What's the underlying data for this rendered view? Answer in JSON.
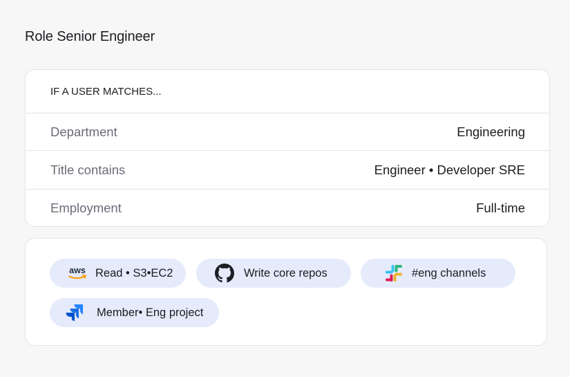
{
  "role": {
    "title": "Role Senior Engineer"
  },
  "rules": {
    "header": "IF A USER MATCHES...",
    "rows": [
      {
        "label": "Department",
        "value": "Engineering"
      },
      {
        "label": "Title contains",
        "value": "Engineer • Developer SRE"
      },
      {
        "label": "Employment",
        "value": "Full-time"
      }
    ]
  },
  "grants": [
    {
      "app": "aws",
      "icon": "aws-icon",
      "label": "Read • S3•EC2"
    },
    {
      "app": "github",
      "icon": "github-icon",
      "label": "Write core repos"
    },
    {
      "app": "slack",
      "icon": "slack-icon",
      "label": "#eng channels"
    },
    {
      "app": "jira",
      "icon": "jira-icon",
      "label": "Member• Eng project"
    }
  ],
  "colors": {
    "chip_background": "#e5ebfb",
    "card_border": "#e3e3e6",
    "muted_text": "#6b6b78",
    "aws_orange": "#ff9900",
    "jira_blue": "#2684ff"
  }
}
